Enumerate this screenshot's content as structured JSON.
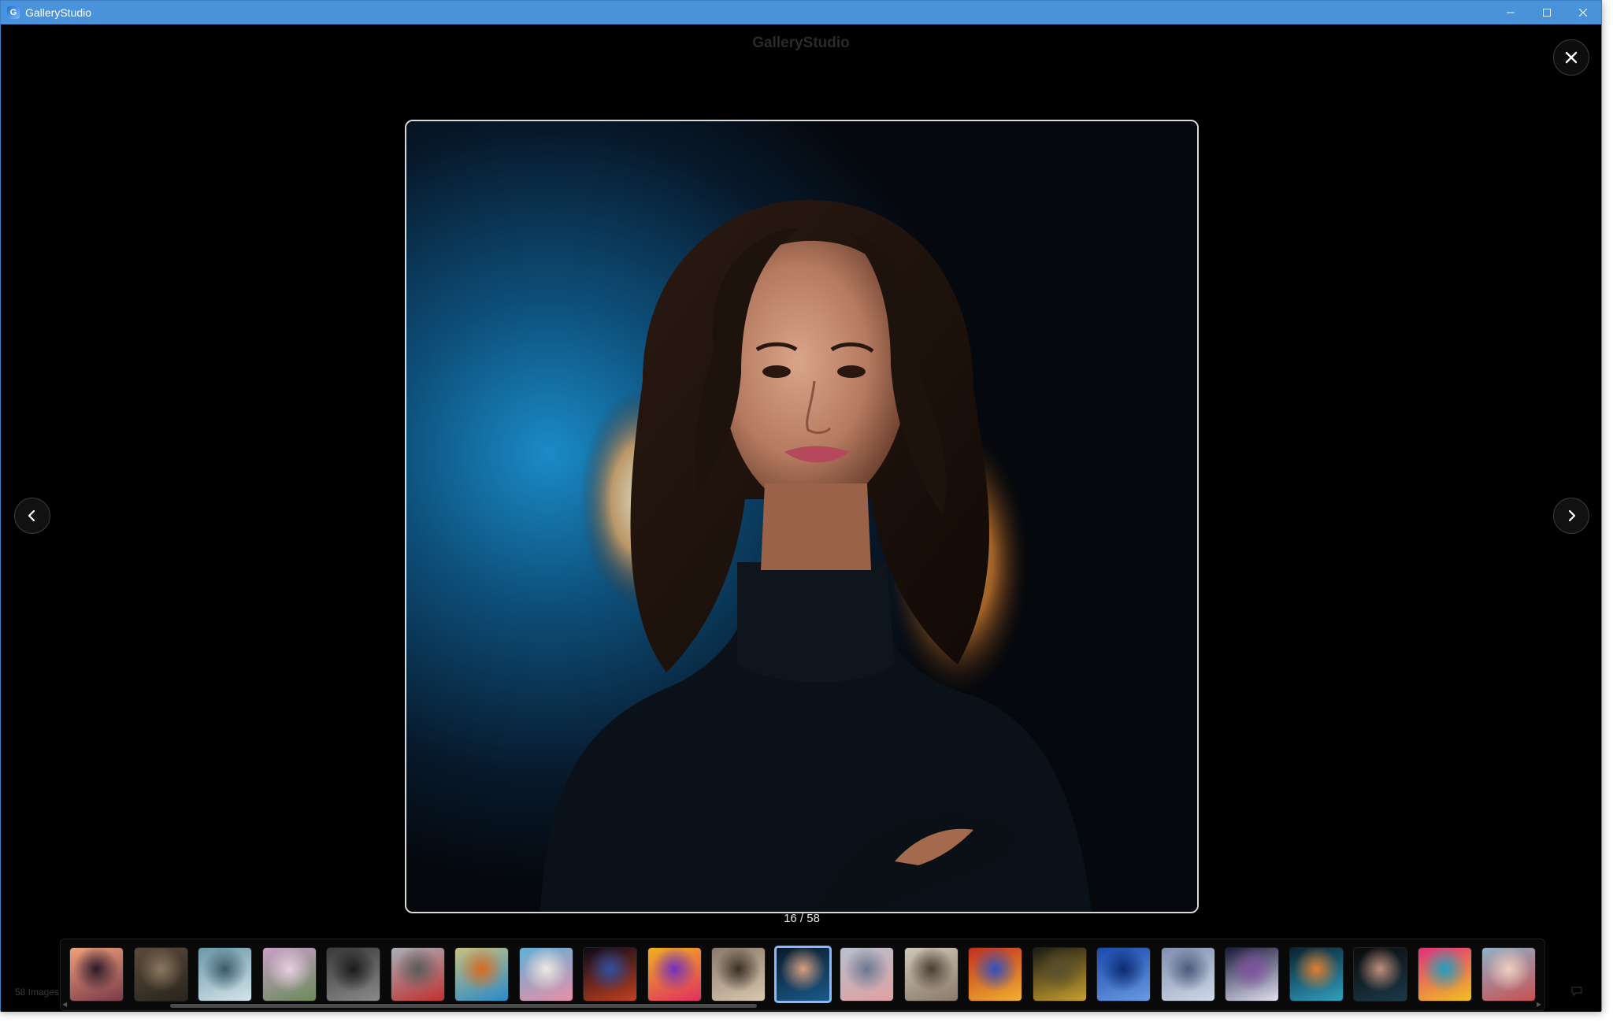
{
  "window": {
    "title": "GalleryStudio",
    "app_icon_letter": "G",
    "controls": {
      "minimize": "—",
      "maximize": "☐",
      "close": "✕"
    }
  },
  "viewer": {
    "title": "GalleryStudio",
    "counter": "16 / 58",
    "image_count_label": "58 Images",
    "icons": {
      "close": "close-icon",
      "previous": "chevron-left-icon",
      "next": "chevron-right-icon"
    }
  },
  "filmstrip": {
    "selected_index": 11,
    "thumbnails": [
      {
        "name": "thumb-mountain-sunset",
        "colors": [
          "#f0a07a",
          "#7a3a4a",
          "#2a1a2a"
        ]
      },
      {
        "name": "thumb-cathedral-interior",
        "colors": [
          "#5a4a3a",
          "#2a241c",
          "#8a7860"
        ]
      },
      {
        "name": "thumb-snowy-forest",
        "colors": [
          "#6a98a8",
          "#d4e4ea",
          "#3a5a6a"
        ]
      },
      {
        "name": "thumb-cherry-blossom",
        "colors": [
          "#c8a0c8",
          "#6a8a5a",
          "#e8d0e0"
        ]
      },
      {
        "name": "thumb-vintage-car",
        "colors": [
          "#3a3a3a",
          "#8a8a8a",
          "#1a1a1a"
        ]
      },
      {
        "name": "thumb-marathon-runners",
        "colors": [
          "#a8b0b8",
          "#c03030",
          "#5a5a5a"
        ]
      },
      {
        "name": "thumb-kingfisher",
        "colors": [
          "#c8c080",
          "#2a8ac8",
          "#d86a20"
        ]
      },
      {
        "name": "thumb-pink-lake",
        "colors": [
          "#60b0d8",
          "#e890a8",
          "#f0e8e0"
        ]
      },
      {
        "name": "thumb-city-night",
        "colors": [
          "#0a0a1a",
          "#c04020",
          "#3050a0"
        ]
      },
      {
        "name": "thumb-pop-art-portrait",
        "colors": [
          "#f0b020",
          "#e03060",
          "#7030c0"
        ]
      },
      {
        "name": "thumb-gothic-arches",
        "colors": [
          "#8a7a6a",
          "#d8c8b0",
          "#3a2e24"
        ]
      },
      {
        "name": "thumb-portrait-woman",
        "colors": [
          "#0a1a2a",
          "#1a5a8a",
          "#d8a080"
        ]
      },
      {
        "name": "thumb-hot-air-balloons",
        "colors": [
          "#b8c0d0",
          "#e0a0a0",
          "#6a7890"
        ]
      },
      {
        "name": "thumb-elderly-man",
        "colors": [
          "#d0c8b8",
          "#8a7a6a",
          "#4a3e34"
        ]
      },
      {
        "name": "thumb-lanterns",
        "colors": [
          "#c03020",
          "#f0b030",
          "#3050c0"
        ]
      },
      {
        "name": "thumb-surfer-wave",
        "colors": [
          "#1a1a14",
          "#c8a030",
          "#5a5030"
        ]
      },
      {
        "name": "thumb-glass-skyscraper",
        "colors": [
          "#1a4ab0",
          "#6a9ae0",
          "#0a2a70"
        ]
      },
      {
        "name": "thumb-minimal-building",
        "colors": [
          "#8090b0",
          "#d0d8e8",
          "#4a5a7a"
        ]
      },
      {
        "name": "thumb-light-trails",
        "colors": [
          "#1a1a3a",
          "#e0e0f0",
          "#8050a0"
        ]
      },
      {
        "name": "thumb-rainy-street",
        "colors": [
          "#0a2030",
          "#30a0c0",
          "#e08030"
        ]
      },
      {
        "name": "thumb-portrait-dark",
        "colors": [
          "#0a0a0a",
          "#1a3a4a",
          "#c09080"
        ]
      },
      {
        "name": "thumb-colorful-fashion",
        "colors": [
          "#e03080",
          "#f0c020",
          "#20a0c0"
        ]
      },
      {
        "name": "thumb-friends-graffiti",
        "colors": [
          "#90b0c8",
          "#c85050",
          "#f0d0c0"
        ]
      }
    ]
  }
}
